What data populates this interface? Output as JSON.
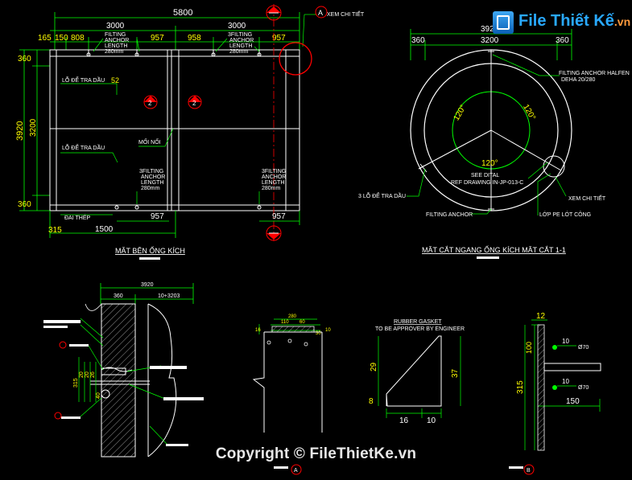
{
  "watermark": {
    "logo_main": "File Thiết Kế",
    "logo_ext": ".vn",
    "copyright": "Copyright © FileThietKe.vn"
  },
  "side_view": {
    "title": "MẶT BÊN ỐNG KÍCH",
    "dims_top": {
      "overall": "5800",
      "left_half": "3000",
      "right_half": "3000",
      "d165": "165",
      "d150": "150",
      "d808": "808",
      "d957a": "957",
      "d958": "958",
      "d957b": "957"
    },
    "dims_left": {
      "top": "360",
      "overall": "3920",
      "mid": "3200",
      "bottom": "360"
    },
    "dims_bottom": {
      "d957a": "957",
      "d1500": "1500",
      "d315": "315",
      "d957b": "957"
    },
    "labels": {
      "filting1": [
        "FILTING",
        "ANCHOR",
        "LENGTH",
        "280mm"
      ],
      "filting2": [
        "3FILTING",
        "ANCHOR",
        "LENGTH",
        "280mm"
      ],
      "filting3": [
        "3FILTING",
        "ANCHOR",
        "LENGTH",
        "280mm"
      ],
      "filting4": [
        "3FILTING",
        "ANCHOR",
        "LENGTH",
        "280mm"
      ],
      "lo_de1": "LỖ ĐỂ TRA DẦU",
      "lo_de2": "LỖ ĐỂ TRA DẦU",
      "moi_noi": "MỐI NỐI",
      "dai_thep": "ĐAI THÉP",
      "val52": "52",
      "xem_chi_tiet": "XEM CHI TIẾT",
      "callout_a": "A",
      "section_no": "2"
    }
  },
  "cross_section": {
    "title": "MẶT CẮT NGANG ỐNG KÍCH MẶT CẮT 1-1",
    "dims": {
      "overall": "3920",
      "inner": "3200",
      "left": "360",
      "right": "360"
    },
    "labels": {
      "anchor_halfen": "FILTING ANCHOR HALFEN",
      "anchor_spec": "DEHA 20/280",
      "angle1": "120°",
      "angle2": "120°",
      "angle3": "120°",
      "see_dital": "SEE DITAL",
      "ref_drawing": "REF DRAWING IN-JP-013-C",
      "lo3": "3 LỖ ĐỂ TRA DẦU",
      "xem": "XEM CHI TIẾT",
      "filting_anchor": "FILTING ANCHOR",
      "lop_pe": "LỚP PE LÓT CÔNG"
    }
  },
  "detail_a": {
    "dims": {
      "top": "3920",
      "d360": "360",
      "d10": "10+3203"
    },
    "vdims": [
      "315",
      "20",
      "20",
      "26",
      "40"
    ]
  },
  "detail_b": {
    "dims": {
      "top": "280",
      "d110": "110",
      "d60": "60",
      "d30": "30",
      "d16": "16",
      "d10": "10"
    }
  },
  "rubber_gasket": {
    "title": "RUBBER GASKET",
    "subtitle": "TO BE APPROVER BY ENGINEER",
    "dims": {
      "h29": "29",
      "h37": "37",
      "h8": "8",
      "w16": "16",
      "w10": "10"
    }
  },
  "detail_c": {
    "dims": {
      "top": "12",
      "h100": "100",
      "h315": "315",
      "w150": "150",
      "d10a": "10",
      "d10b": "10",
      "phi1": "Ø70",
      "phi2": "Ø70"
    }
  },
  "detail_tags": {
    "a": "A",
    "b": "B"
  },
  "colors": {
    "white": "#ffffff",
    "green": "#00ff00",
    "yellow": "#ffff00",
    "red": "#ff0000",
    "cyan": "#00ffff"
  }
}
